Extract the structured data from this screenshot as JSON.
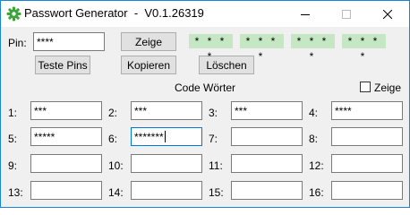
{
  "window": {
    "title": "Passwort Generator  -  V0.1.26319",
    "icon": "gear-green-icon",
    "controls": [
      "minimize-icon",
      "maximize-icon",
      "close-icon"
    ]
  },
  "pin": {
    "label": "Pin:",
    "value": "****"
  },
  "buttons": {
    "zeige": "Zeige",
    "teste_pins": "Teste Pins",
    "kopieren": "Kopieren",
    "loeschen": "Löschen"
  },
  "pin_displays": [
    "* * * *",
    "* * * *",
    "* * * *",
    "* * * *"
  ],
  "code_words": {
    "heading": "Code Wörter",
    "show_label": "Zeige",
    "show_checked": false,
    "fields": [
      {
        "label": "1:",
        "value": "***"
      },
      {
        "label": "2:",
        "value": "***"
      },
      {
        "label": "3:",
        "value": "***"
      },
      {
        "label": "4:",
        "value": "****"
      },
      {
        "label": "5:",
        "value": "*****"
      },
      {
        "label": "6:",
        "value": "*******"
      },
      {
        "label": "7:",
        "value": ""
      },
      {
        "label": "8:",
        "value": ""
      },
      {
        "label": "9:",
        "value": ""
      },
      {
        "label": "10:",
        "value": ""
      },
      {
        "label": "11:",
        "value": ""
      },
      {
        "label": "12:",
        "value": ""
      },
      {
        "label": "13:",
        "value": ""
      },
      {
        "label": "14:",
        "value": ""
      },
      {
        "label": "15:",
        "value": ""
      },
      {
        "label": "16:",
        "value": ""
      }
    ]
  },
  "colors": {
    "pin_display_bg": "#c6e7c3",
    "focus_border": "#0078d7",
    "window_border": "#1883d7"
  }
}
